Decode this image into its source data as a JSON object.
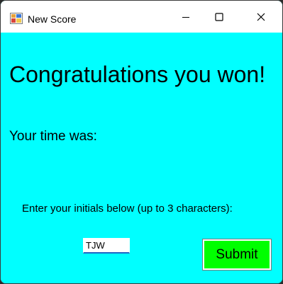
{
  "window": {
    "title": "New Score",
    "background": "#00ffff"
  },
  "titlebar": {
    "icon": "app-icon",
    "controls": [
      "minimize-icon",
      "maximize-icon",
      "close-icon"
    ]
  },
  "content": {
    "headline": "Congratulations you won!",
    "time_label": "Your time was:",
    "prompt": "Enter your initials below (up to 3 characters):",
    "initials_value": "TJW",
    "submit_label": "Submit",
    "submit_color": "#00ff00"
  }
}
